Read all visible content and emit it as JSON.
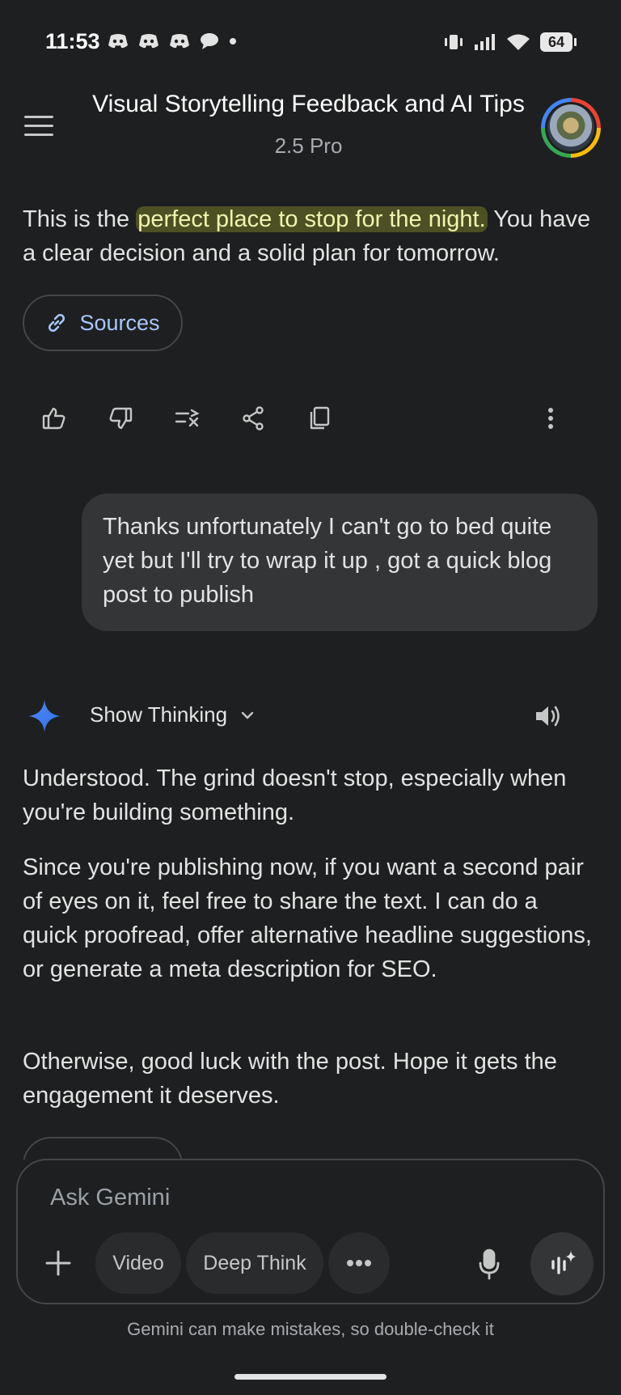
{
  "status_bar": {
    "time": "11:53",
    "battery": "64",
    "left_icons": [
      "discord-icon",
      "discord-icon",
      "discord-icon",
      "chat-bubble-icon",
      "dot-icon"
    ],
    "right_icons": [
      "vibrate-icon",
      "signal-icon",
      "wifi-icon",
      "battery-icon"
    ]
  },
  "header": {
    "title": "Visual Storytelling Feedback and AI Tips",
    "model": "2.5 Pro"
  },
  "response_prev": {
    "text_before": "This is the ",
    "text_highlight": "perfect place to stop for the night.",
    "text_after": " You have a clear decision and a solid plan for tomorrow.",
    "sources_label": "Sources",
    "actions": [
      "thumbs-up-icon",
      "thumbs-down-icon",
      "modify-response-icon",
      "share-icon",
      "copy-icon",
      "more-vert-icon"
    ]
  },
  "user_message": {
    "text": "Thanks unfortunately I can't go to bed quite yet but I'll try to wrap it up , got a quick blog post to publish"
  },
  "response": {
    "show_thinking_label": "Show Thinking",
    "paragraphs": [
      "Understood. The grind doesn't stop, especially when you're building something.",
      "Since you're publishing now, if you want a second pair of eyes on it, feel free to share the text. I can do a quick proofread, offer alternative headline suggestions, or generate a meta description for SEO.",
      "Otherwise, good luck with the post. Hope it gets the engagement it deserves."
    ]
  },
  "composer": {
    "placeholder": "Ask Gemini",
    "chips": [
      "Video",
      "Deep Think"
    ],
    "more_label": "•••"
  },
  "disclaimer": "Gemini can make mistakes, so double-check it",
  "colors": {
    "background": "#1e1f20",
    "bubble": "#333537",
    "link": "#a8c7fa",
    "highlight": "#c8d028"
  }
}
